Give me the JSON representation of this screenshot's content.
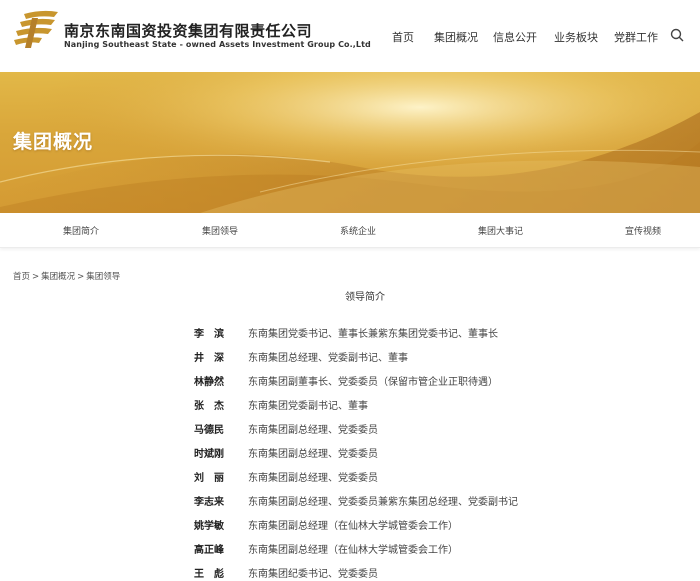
{
  "brand": {
    "name_cn": "南京东南国资投资集团有限责任公司",
    "name_en": "Nanjing Southeast State - owned Assets Investment Group Co.,Ltd"
  },
  "nav": {
    "items": [
      "首页",
      "集团概况",
      "信息公开",
      "业务板块",
      "党群工作"
    ]
  },
  "banner": {
    "title": "集团概况"
  },
  "subnav": {
    "items": [
      "集团简介",
      "集团领导",
      "系统企业",
      "集团大事记",
      "宣传视频"
    ]
  },
  "breadcrumb": {
    "items": [
      "首页",
      "集团概况",
      "集团领导"
    ],
    "separator": ">"
  },
  "section": {
    "title": "领导简介"
  },
  "leaders": [
    {
      "name": "李　滨",
      "title": "东南集团党委书记、董事长兼紫东集团党委书记、董事长"
    },
    {
      "name": "井　深",
      "title": "东南集团总经理、党委副书记、董事"
    },
    {
      "name": "林静然",
      "title": " 东南集团副董事长、党委委员（保留市管企业正职待遇）"
    },
    {
      "name": "张　杰",
      "title": "东南集团党委副书记、董事"
    },
    {
      "name": "马德民",
      "title": "东南集团副总经理、党委委员"
    },
    {
      "name": "时斌刚",
      "title": "东南集团副总经理、党委委员"
    },
    {
      "name": "刘　丽",
      "title": "东南集团副总经理、党委委员"
    },
    {
      "name": "李志来",
      "title": "东南集团副总经理、党委委员兼紫东集团总经理、党委副书记"
    },
    {
      "name": "姚学敏",
      "title": "东南集团副总经理（在仙林大学城管委会工作）"
    },
    {
      "name": "高正峰",
      "title": "东南集团副总经理（在仙林大学城管委会工作）"
    },
    {
      "name": "王　彪",
      "title": "东南集团纪委书记、党委委员"
    }
  ]
}
